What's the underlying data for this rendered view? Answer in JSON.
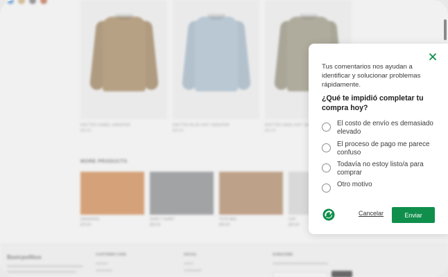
{
  "background": {
    "products_row": [
      {
        "name": "KNITTED CAMEL SWEATER",
        "price": "$59.00",
        "color": "#9a7a4e"
      },
      {
        "name": "KNITTED BLUE KNIT SWEATER",
        "price": "$59.00",
        "color": "#9fb5c6"
      },
      {
        "name": "KNITTED SAGE KNIT SWEATER",
        "price": "$59.00",
        "color": "#8f8b74"
      }
    ],
    "more_title": "MORE PRODUCTS",
    "more_products": [
      {
        "name": "SNEAKERS",
        "price": "$79.00",
        "color": "#c97a3c"
      },
      {
        "name": "SHIRT T-SHIRT",
        "price": "$39.00",
        "color": "#55585c"
      },
      {
        "name": "TOTE BAG",
        "price": "$49.00",
        "color": "#8b5a36"
      },
      {
        "name": "CAP",
        "price": "$29.00",
        "color": "#bdbdbd"
      }
    ],
    "footer": {
      "brand": "Basicpullbus",
      "col1": "CUSTOMER CARE",
      "col2": "SOCIAL",
      "col3": "SUBSCRIBE"
    }
  },
  "survey": {
    "intro": "Tus comentarios nos ayudan a identificar y solucionar problemas rápidamente.",
    "question": "¿Qué te impidió completar tu compra hoy?",
    "options": [
      "El costo de envío es demasiado elevado",
      "El proceso de pago me parece confuso",
      "Todavía no estoy listo/a para comprar",
      "Otro motivo"
    ],
    "cancel_label": "Cancelar",
    "submit_label": "Enviar",
    "close_icon": "close-icon",
    "accent_color": "#0f8f4b"
  }
}
